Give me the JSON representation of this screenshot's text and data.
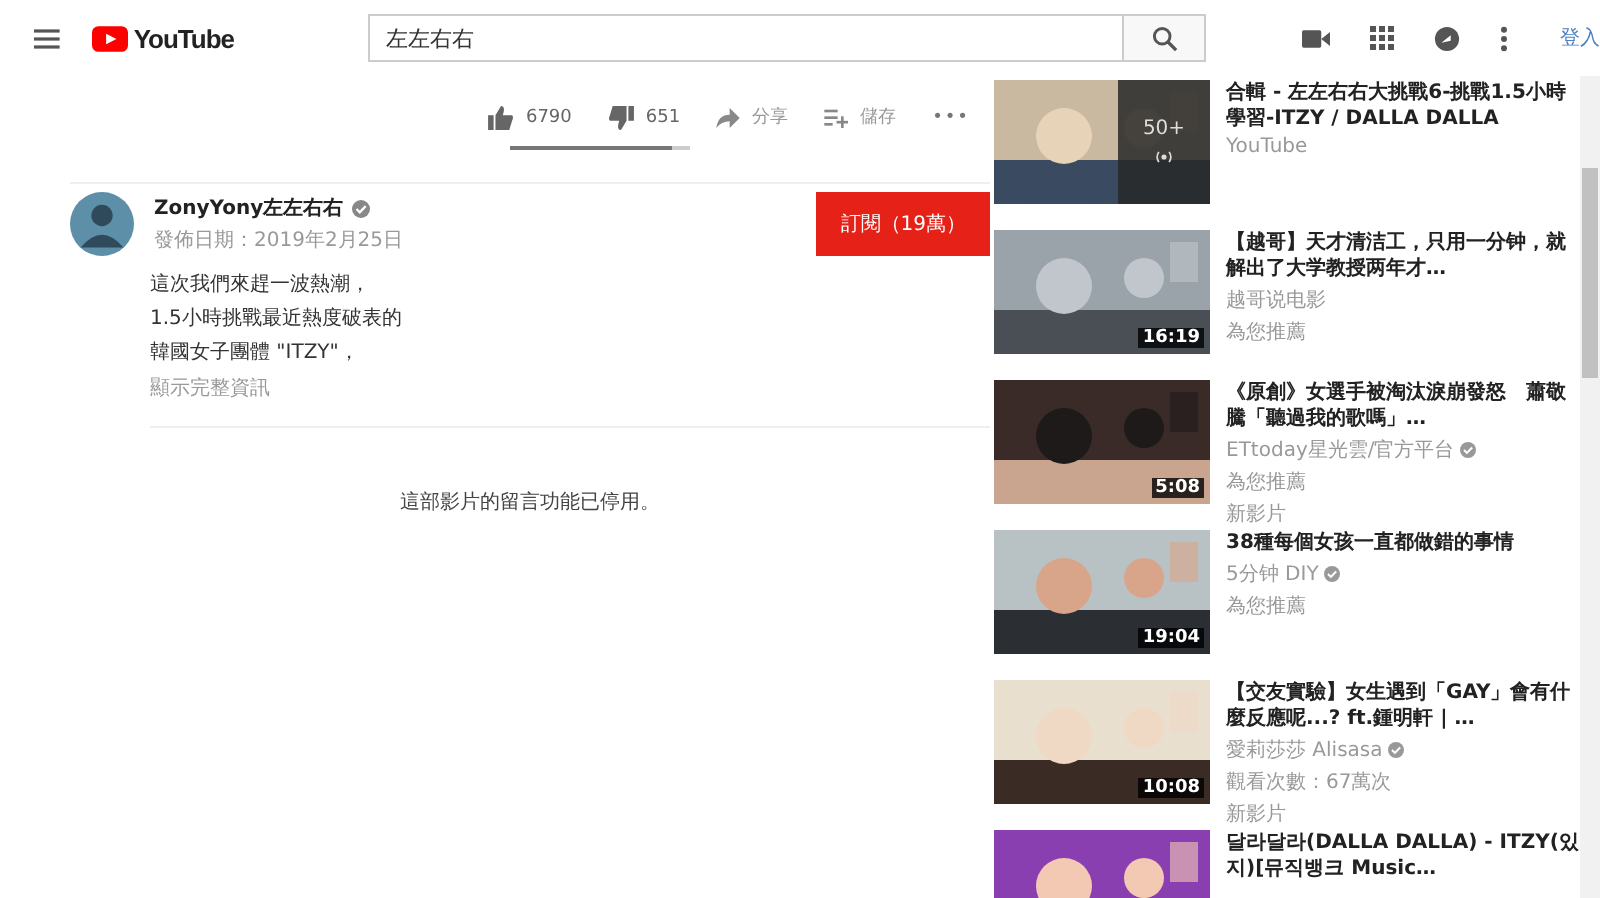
{
  "header": {
    "logo": "YouTube",
    "search": {
      "value": "左左右右"
    },
    "sign_in": "登入"
  },
  "actions": {
    "likes": "6790",
    "dislikes": "651",
    "share": "分享",
    "save": "儲存",
    "more": "•••"
  },
  "channel": {
    "name": "ZonyYony左左右右",
    "verified": true,
    "date": "發佈日期：2019年2月25日",
    "subscribe": "訂閱（19萬）"
  },
  "description": [
    "這次我們來趕一波熱潮，",
    "1.5小時挑戰最近熱度破表的",
    "韓國女子團體 \"ITZY\"，"
  ],
  "show_more": "顯示完整資訊",
  "comments_notice": "這部影片的留言功能已停用。",
  "related": [
    {
      "title": "合輯 - 左左右右大挑戰6-挑戰1.5小時學習-ITZY / DALLA DALLA",
      "channel": "YouTube",
      "verified": false,
      "playlist_count": "50+"
    },
    {
      "title": "【越哥】天才清洁工，只用一分钟，就解出了大学教授两年才…",
      "channel": "越哥说电影",
      "verified": false,
      "lines": [
        "為您推薦"
      ],
      "duration": "16:19"
    },
    {
      "title": "《原創》女選手被淘汰淚崩發怒　蕭敬騰「聽過我的歌嗎」…",
      "channel": "ETtoday星光雲/官方平台",
      "verified": true,
      "lines": [
        "為您推薦",
        "新影片"
      ],
      "duration": "5:08"
    },
    {
      "title": "38種每個女孩一直都做錯的事情",
      "channel": "5分钟 DIY",
      "verified": true,
      "lines": [
        "為您推薦"
      ],
      "duration": "19:04"
    },
    {
      "title": "【交友實驗】女生遇到「GAY」會有什麼反應呢...? ft.鍾明軒 | …",
      "channel": "愛莉莎莎 Alisasa",
      "verified": true,
      "lines": [
        "觀看次數：67萬次",
        "新影片"
      ],
      "duration": "10:08"
    },
    {
      "title": "달라달라(DALLA DALLA) - ITZY(있지)[뮤직뱅크 Music…"
    }
  ]
}
